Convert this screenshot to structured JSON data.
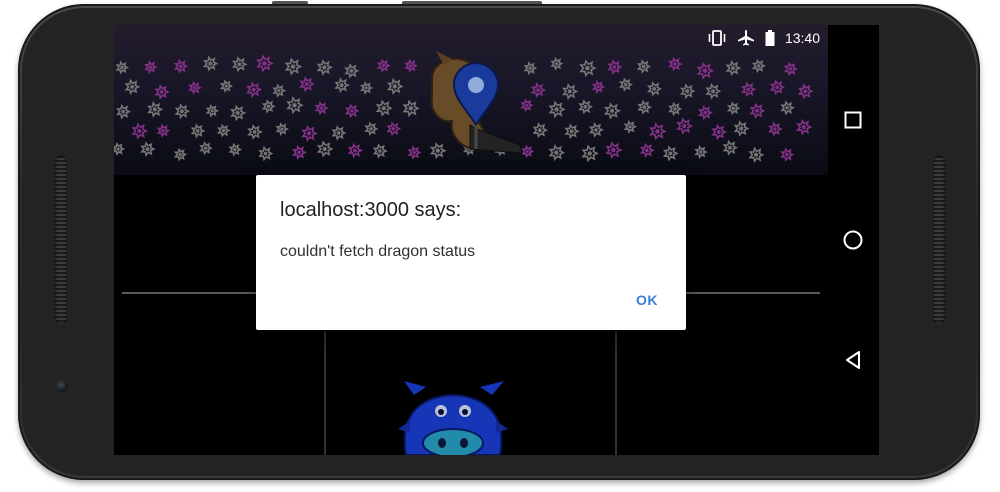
{
  "status_bar": {
    "time": "13:40",
    "icons": [
      "vibrate-icon",
      "airplane-mode-icon",
      "battery-icon"
    ]
  },
  "dialog": {
    "title": "localhost:3000 says:",
    "message": "couldn't fetch dragon status",
    "ok_label": "OK"
  },
  "nav_bar": {
    "icons": [
      "recents-icon",
      "home-icon",
      "back-icon"
    ]
  },
  "colors": {
    "dialog_accent": "#3d7fd6",
    "star_purple": "#9a3a9e",
    "star_gray": "#8a8a8a",
    "dragon_blue": "#1c3fd8"
  }
}
